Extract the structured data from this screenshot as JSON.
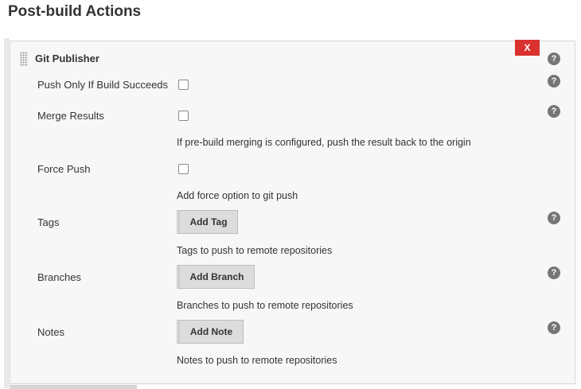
{
  "section": {
    "title": "Post-build Actions"
  },
  "publisher": {
    "title": "Git Publisher",
    "delete_label": "X",
    "help_label": "?"
  },
  "fields": {
    "push_only": {
      "label": "Push Only If Build Succeeds",
      "checked": false
    },
    "merge_results": {
      "label": "Merge Results",
      "checked": false,
      "description": "If pre-build merging is configured, push the result back to the origin"
    },
    "force_push": {
      "label": "Force Push",
      "checked": false,
      "description": "Add force option to git push"
    },
    "tags": {
      "label": "Tags",
      "button": "Add Tag",
      "description": "Tags to push to remote repositories"
    },
    "branches": {
      "label": "Branches",
      "button": "Add Branch",
      "description": "Branches to push to remote repositories"
    },
    "notes": {
      "label": "Notes",
      "button": "Add Note",
      "description": "Notes to push to remote repositories"
    }
  },
  "colors": {
    "delete": "#d9312e",
    "help": "#767676",
    "panel": "#f7f7f7"
  },
  "icons": {
    "help": "help-icon",
    "drag": "drag-handle-icon"
  }
}
